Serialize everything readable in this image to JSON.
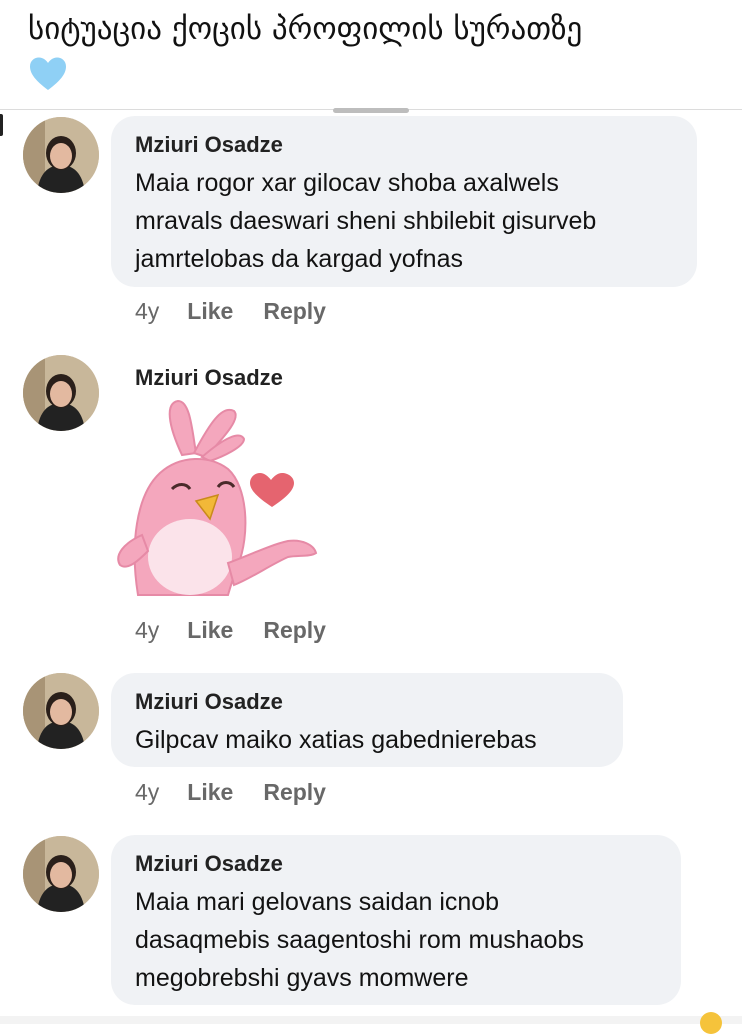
{
  "post": {
    "caption": "სიტუაცია ქოცის პროფილის სურათზე",
    "caption_emoji": "light-blue-heart"
  },
  "comments": [
    {
      "author": "Mziuri Osadze",
      "lines": [
        "Maia rogor xar  gilocav shoba axalwels",
        "mravals daeswari sheni shbilebit gisurveb",
        "jamrtelobas da kargad yofnas"
      ],
      "time": "4y",
      "like": "Like",
      "reply": "Reply"
    },
    {
      "author": "Mziuri Osadze",
      "sticker": "pink-bird-blowing-kiss",
      "time": "4y",
      "like": "Like",
      "reply": "Reply"
    },
    {
      "author": "Mziuri Osadze",
      "lines": [
        "Gilpcav maiko xatias gabednierebas"
      ],
      "time": "4y",
      "like": "Like",
      "reply": "Reply"
    },
    {
      "author": "Mziuri Osadze",
      "lines": [
        "Maia mari gelovans saidan icnob",
        "dasaqmebis saagentoshi rom mushaobs",
        "megobrebshi gyavs momwere"
      ]
    }
  ],
  "colors": {
    "bubble": "#f0f2f5",
    "meta_text": "#686868",
    "heart_blue": "#8fd0f5",
    "sticker_pink": "#f4a7bd"
  }
}
